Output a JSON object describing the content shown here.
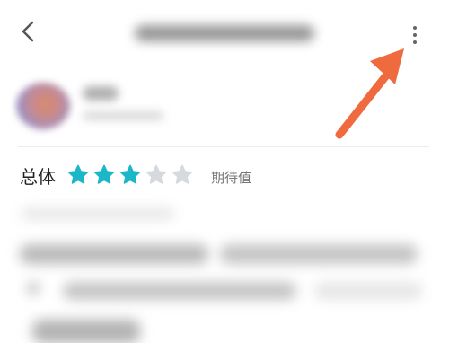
{
  "header": {
    "back_icon": "chevron-left-icon",
    "more_icon": "vertical-ellipsis-icon"
  },
  "rating": {
    "label": "总体",
    "value": 3,
    "max": 5,
    "hint": "期待值",
    "filled_color": "#1bb7c8",
    "empty_color": "#d6d9dd"
  },
  "annotation": {
    "arrow_color": "#f06a3f"
  }
}
